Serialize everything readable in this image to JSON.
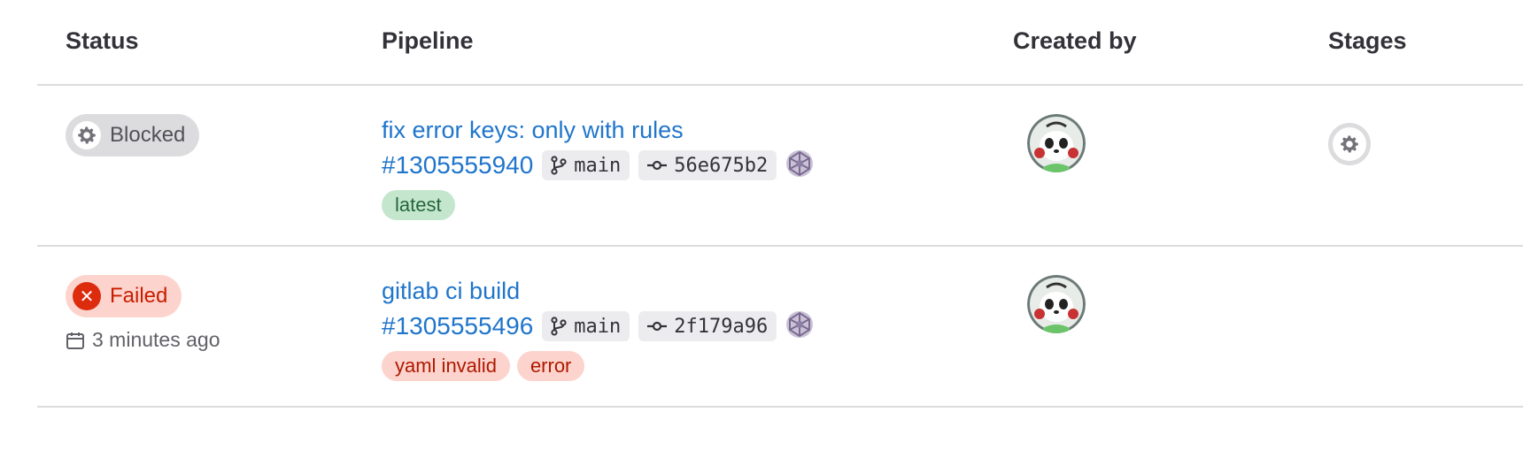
{
  "headers": {
    "status": "Status",
    "pipeline": "Pipeline",
    "created_by": "Created by",
    "stages": "Stages"
  },
  "rows": [
    {
      "status": "Blocked",
      "status_icon": "gear-icon",
      "title": "fix error keys: only with rules",
      "id": "#1305555940",
      "branch": "main",
      "commit": "56e675b2",
      "labels": [
        "latest"
      ]
    },
    {
      "status": "Failed",
      "status_icon": "close-icon",
      "time_ago": "3 minutes ago",
      "title": "gitlab ci build",
      "id": "#1305555496",
      "branch": "main",
      "commit": "2f179a96",
      "labels": [
        "yaml invalid",
        "error"
      ]
    }
  ],
  "colors": {
    "link": "#1f75cb",
    "blocked_bg": "#dcdcde",
    "failed_bg": "#fdd4cd",
    "failed_icon": "#dd2b0e",
    "latest_bg": "#c3e6cd"
  }
}
